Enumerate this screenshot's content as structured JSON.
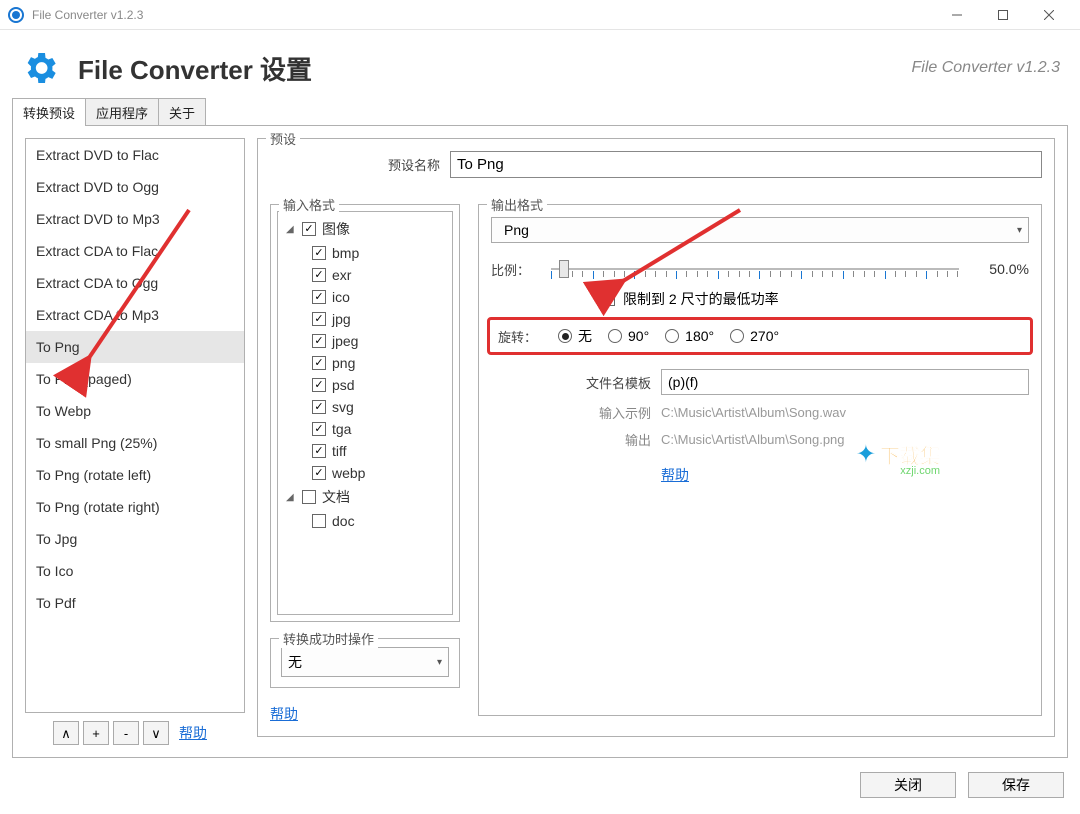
{
  "titlebar": {
    "title": "File Converter v1.2.3"
  },
  "header": {
    "heading": "File Converter 设置",
    "version": "File Converter v1.2.3"
  },
  "tabs": [
    "转换预设",
    "应用程序",
    "关于"
  ],
  "presets": [
    "Extract DVD to Flac",
    "Extract DVD to Ogg",
    "Extract DVD to Mp3",
    "Extract CDA to Flac",
    "Extract CDA to Ogg",
    "Extract CDA to Mp3",
    "To Png",
    "To Png (paged)",
    "To Webp",
    "To small Png (25%)",
    "To Png (rotate left)",
    "To Png (rotate right)",
    "To Jpg",
    "To Ico",
    "To Pdf"
  ],
  "selected_preset_index": 6,
  "preset_buttons": {
    "up": "∧",
    "add": "+",
    "remove": "-",
    "down": "∨"
  },
  "help_label": "帮助",
  "preset_section": {
    "legend": "预设",
    "name_label": "预设名称",
    "name_value": "To Png"
  },
  "input_formats": {
    "legend": "输入格式",
    "groups": [
      {
        "label": "图像",
        "checked": true,
        "expanded": true,
        "children": [
          {
            "label": "bmp",
            "checked": true
          },
          {
            "label": "exr",
            "checked": true
          },
          {
            "label": "ico",
            "checked": true
          },
          {
            "label": "jpg",
            "checked": true
          },
          {
            "label": "jpeg",
            "checked": true
          },
          {
            "label": "png",
            "checked": true
          },
          {
            "label": "psd",
            "checked": true
          },
          {
            "label": "svg",
            "checked": true
          },
          {
            "label": "tga",
            "checked": true
          },
          {
            "label": "tiff",
            "checked": true
          },
          {
            "label": "webp",
            "checked": true
          }
        ]
      },
      {
        "label": "文档",
        "checked": false,
        "expanded": true,
        "children": [
          {
            "label": "doc",
            "checked": false
          }
        ]
      }
    ]
  },
  "on_success": {
    "legend": "转换成功时操作",
    "value": "无"
  },
  "output": {
    "legend": "输出格式",
    "format": "Png",
    "scale_label": "比例：",
    "scale_value": "50.0%",
    "limit_label": "限制到 2 尺寸的最低功率",
    "limit_checked": false,
    "rotate_label": "旋转：",
    "rotate_options": [
      "无",
      "90°",
      "180°",
      "270°"
    ],
    "rotate_selected": 0,
    "template_label": "文件名模板",
    "template_value": "(p)(f)",
    "input_example_label": "输入示例",
    "input_example_value": "C:\\Music\\Artist\\Album\\Song.wav",
    "output_example_label": "输出",
    "output_example_value": "C:\\Music\\Artist\\Album\\Song.png"
  },
  "footer": {
    "close": "关闭",
    "save": "保存"
  },
  "watermark": {
    "text": "下载集",
    "url": "xzji.com"
  }
}
